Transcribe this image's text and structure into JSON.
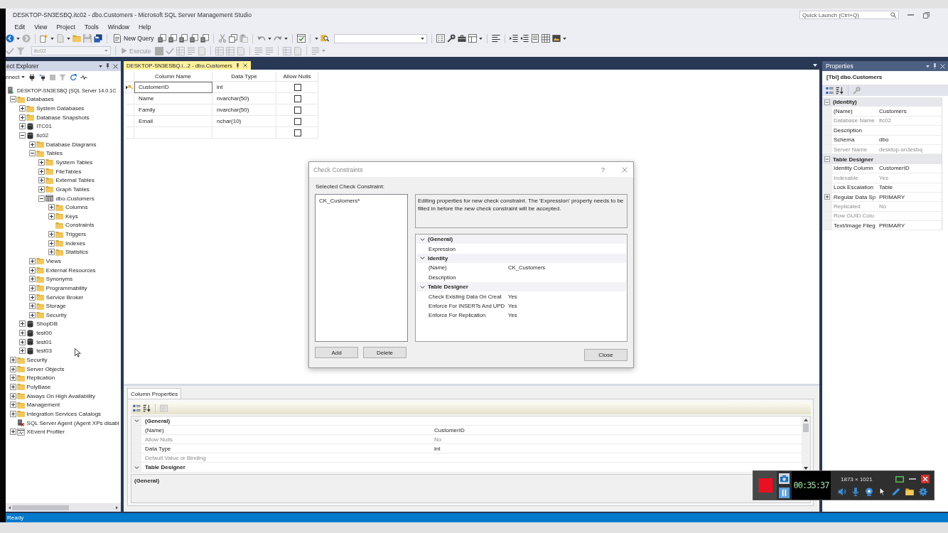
{
  "window": {
    "title": "DESKTOP-SN3ESBQ.itc02 - dbo.Customers - Microsoft SQL Server Management Studio",
    "quick_launch": {
      "placeholder": "Quick Launch (Ctrl+Q)"
    }
  },
  "menu": [
    {
      "label": "Edit"
    },
    {
      "label": "View"
    },
    {
      "label": "Project"
    },
    {
      "label": "Tools"
    },
    {
      "label": "Window"
    },
    {
      "label": "Help"
    }
  ],
  "toolbar": {
    "new_query": "New Query",
    "database": {
      "value": "itc02",
      "disabled": true
    },
    "execute": {
      "label": "Execute",
      "disabled": true
    }
  },
  "object_explorer": {
    "title": "ect Explorer",
    "connect": "nnect",
    "tree": [
      {
        "label": "DESKTOP-SN3ESBQ (SQL Server 14.0.1C",
        "kind": "server",
        "children": [
          {
            "label": "Databases",
            "kind": "folder",
            "expanded": true,
            "children": [
              {
                "label": "System Databases",
                "kind": "folder",
                "expanded": false
              },
              {
                "label": "Database Snapshots",
                "kind": "folder",
                "expanded": false
              },
              {
                "label": "ITC01",
                "kind": "database",
                "expanded": false
              },
              {
                "label": "itc02",
                "kind": "database",
                "expanded": true,
                "children": [
                  {
                    "label": "Database Diagrams",
                    "kind": "folder",
                    "expanded": false
                  },
                  {
                    "label": "Tables",
                    "kind": "folder",
                    "expanded": true,
                    "children": [
                      {
                        "label": "System Tables",
                        "kind": "folder",
                        "expanded": false
                      },
                      {
                        "label": "FileTables",
                        "kind": "folder",
                        "expanded": false
                      },
                      {
                        "label": "External Tables",
                        "kind": "folder",
                        "expanded": false
                      },
                      {
                        "label": "Graph Tables",
                        "kind": "folder",
                        "expanded": false
                      },
                      {
                        "label": "dbo.Customers",
                        "kind": "table",
                        "expanded": true,
                        "children": [
                          {
                            "label": "Columns",
                            "kind": "folder",
                            "expanded": false
                          },
                          {
                            "label": "Keys",
                            "kind": "folder",
                            "expanded": false
                          },
                          {
                            "label": "Constraints",
                            "kind": "folder"
                          },
                          {
                            "label": "Triggers",
                            "kind": "folder",
                            "expanded": false
                          },
                          {
                            "label": "Indexes",
                            "kind": "folder",
                            "expanded": false
                          },
                          {
                            "label": "Statistics",
                            "kind": "folder",
                            "expanded": false
                          }
                        ]
                      }
                    ]
                  },
                  {
                    "label": "Views",
                    "kind": "folder",
                    "expanded": false
                  },
                  {
                    "label": "External Resources",
                    "kind": "folder",
                    "expanded": false
                  },
                  {
                    "label": "Synonyms",
                    "kind": "folder",
                    "expanded": false
                  },
                  {
                    "label": "Programmability",
                    "kind": "folder",
                    "expanded": false
                  },
                  {
                    "label": "Service Broker",
                    "kind": "folder",
                    "expanded": false
                  },
                  {
                    "label": "Storage",
                    "kind": "folder",
                    "expanded": false
                  },
                  {
                    "label": "Security",
                    "kind": "folder",
                    "expanded": false
                  }
                ]
              },
              {
                "label": "ShopDB",
                "kind": "database",
                "expanded": false
              },
              {
                "label": "test00",
                "kind": "database",
                "expanded": false
              },
              {
                "label": "test01",
                "kind": "database",
                "expanded": false
              },
              {
                "label": "test03",
                "kind": "database",
                "expanded": false
              }
            ]
          },
          {
            "label": "Security",
            "kind": "folder",
            "expanded": false
          },
          {
            "label": "Server Objects",
            "kind": "folder",
            "expanded": false
          },
          {
            "label": "Replication",
            "kind": "folder",
            "expanded": false
          },
          {
            "label": "PolyBase",
            "kind": "folder",
            "expanded": false
          },
          {
            "label": "Always On High Availability",
            "kind": "folder",
            "expanded": false
          },
          {
            "label": "Management",
            "kind": "folder",
            "expanded": false
          },
          {
            "label": "Integration Services Catalogs",
            "kind": "folder",
            "expanded": false
          },
          {
            "label": "SQL Server Agent (Agent XPs disabl",
            "kind": "agent"
          },
          {
            "label": "XEvent Profiler",
            "kind": "profiler",
            "expanded": false
          }
        ]
      }
    ]
  },
  "document_tab": {
    "title": "DESKTOP-SN3ESBQ.i...2 - dbo.Customers",
    "selected": true
  },
  "table_designer": {
    "columns": [
      {
        "label": "Column Name"
      },
      {
        "label": "Data Type"
      },
      {
        "label": "Allow Nulls"
      }
    ],
    "rows": [
      {
        "column_name": "CustomerID",
        "data_type": "int",
        "allow_nulls": false,
        "primary_key": true,
        "selected": true
      },
      {
        "column_name": "Name",
        "data_type": "nvarchar(50)",
        "allow_nulls": false,
        "primary_key": false,
        "selected": false
      },
      {
        "column_name": "Family",
        "data_type": "nvarchar(50)",
        "allow_nulls": false,
        "primary_key": false,
        "selected": false
      },
      {
        "column_name": "Email",
        "data_type": "nchar(10)",
        "allow_nulls": false,
        "primary_key": false,
        "selected": false
      },
      {
        "allow_nulls": false,
        "primary_key": false,
        "selected": false
      }
    ]
  },
  "check_constraints_dialog": {
    "title": "Check Constraints",
    "help": "?",
    "list_label": "Selected Check Constraint:",
    "constraints": [
      {
        "name": "CK_Customers*",
        "selected": false
      }
    ],
    "description": "Editing properties for new check constraint. The 'Expression' property needs to be filled in before the new check constraint will be accepted.",
    "categories": [
      {
        "name": "(General)",
        "expanded": true,
        "items": [
          {
            "name": "Expression"
          }
        ]
      },
      {
        "name": "Identity",
        "expanded": true,
        "items": [
          {
            "name": "(Name)",
            "value": "CK_Customers"
          },
          {
            "name": "Description"
          }
        ]
      },
      {
        "name": "Table Designer",
        "expanded": true,
        "items": [
          {
            "name": "Check Existing Data On Creat",
            "value": "Yes"
          },
          {
            "name": "Enforce For INSERTs And UPD",
            "value": "Yes"
          },
          {
            "name": "Enforce For Replication",
            "value": "Yes"
          }
        ]
      }
    ],
    "buttons": [
      {
        "label": "Add",
        "kind": "add"
      },
      {
        "label": "Delete",
        "kind": "delete"
      },
      {
        "label": "Close",
        "kind": "close"
      }
    ]
  },
  "column_properties": {
    "tab": "Column Properties",
    "categories": [
      {
        "name": "(General)",
        "expanded": true,
        "items": [
          {
            "name": "(Name)",
            "value": "CustomerID",
            "disabled": false
          },
          {
            "name": "Allow Nulls",
            "value": "No",
            "disabled": true
          },
          {
            "name": "Data Type",
            "value": "int",
            "disabled": false
          },
          {
            "name": "Default Value or Binding",
            "disabled": true
          }
        ]
      },
      {
        "name": "Table Designer",
        "expanded": true
      }
    ],
    "description": "(General)"
  },
  "properties_panel": {
    "title": "Properties",
    "object": "[Tbl] dbo.Customers",
    "categories": [
      {
        "name": "(Identity)",
        "expanded": true,
        "items": [
          {
            "name": "(Name)",
            "value": "Customers",
            "disabled": false
          },
          {
            "name": "Database Name",
            "value": "itc02",
            "disabled": true
          },
          {
            "name": "Description",
            "disabled": false
          },
          {
            "name": "Schema",
            "value": "dbo",
            "disabled": false
          },
          {
            "name": "Server Name",
            "value": "desktop-sn3esbq",
            "disabled": true
          }
        ]
      },
      {
        "name": "Table Designer",
        "expanded": true,
        "items": [
          {
            "name": "Identity Column",
            "value": "CustomerID",
            "disabled": false
          },
          {
            "name": "Indexable",
            "value": "Yes",
            "disabled": true
          },
          {
            "name": "Lock Escalation",
            "value": "Table",
            "disabled": false
          },
          {
            "name": "Regular Data Sp",
            "value": "PRIMARY",
            "disabled": false,
            "expanded": false
          },
          {
            "name": "Replicated",
            "value": "No",
            "disabled": true
          },
          {
            "name": "Row GUID Colu",
            "disabled": true
          },
          {
            "name": "Text/Image Fileg",
            "value": "PRIMARY",
            "disabled": false
          }
        ]
      }
    ]
  },
  "status_bar": {
    "text": "Ready"
  },
  "recorder": {
    "time": "00:35:37",
    "resolution": "1873 × 1021"
  }
}
